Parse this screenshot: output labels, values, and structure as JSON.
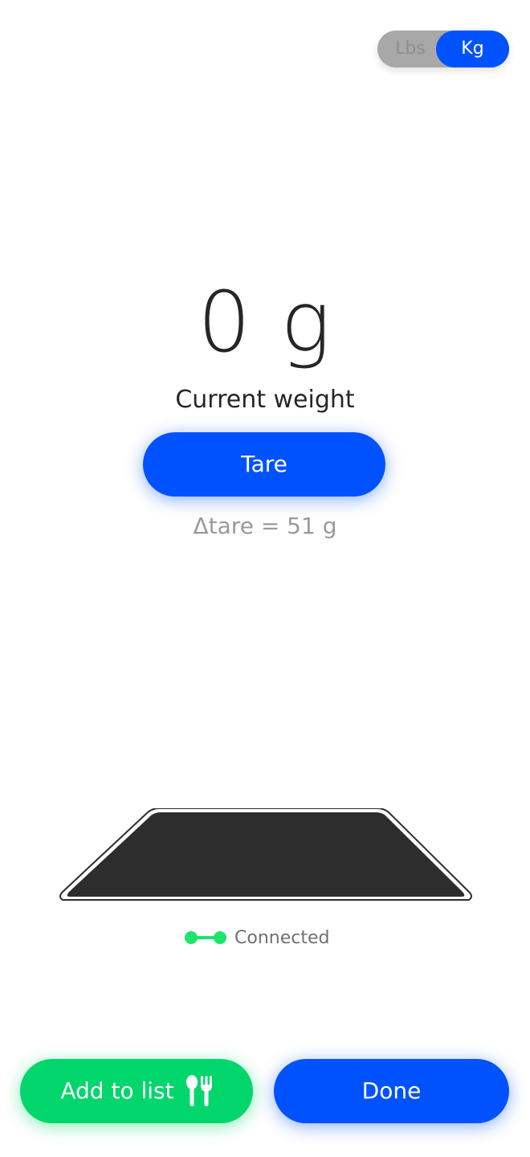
{
  "unit_toggle": {
    "options": [
      "Lbs",
      "Kg"
    ],
    "selected": "Kg"
  },
  "weight": {
    "value": "0 g",
    "label": "Current weight"
  },
  "tare": {
    "button_label": "Tare",
    "delta_text": "Δtare = 51 g"
  },
  "scale": {
    "status_text": "Connected",
    "status_icon": "connected-icon"
  },
  "actions": {
    "add_label": "Add to list",
    "add_icon": "utensils-icon",
    "done_label": "Done"
  },
  "colors": {
    "primary": "#0052ff",
    "success": "#00d66c",
    "connected": "#19e66b",
    "toggle_off": "#a8a8a8",
    "scale_top": "#2d2d2d"
  }
}
